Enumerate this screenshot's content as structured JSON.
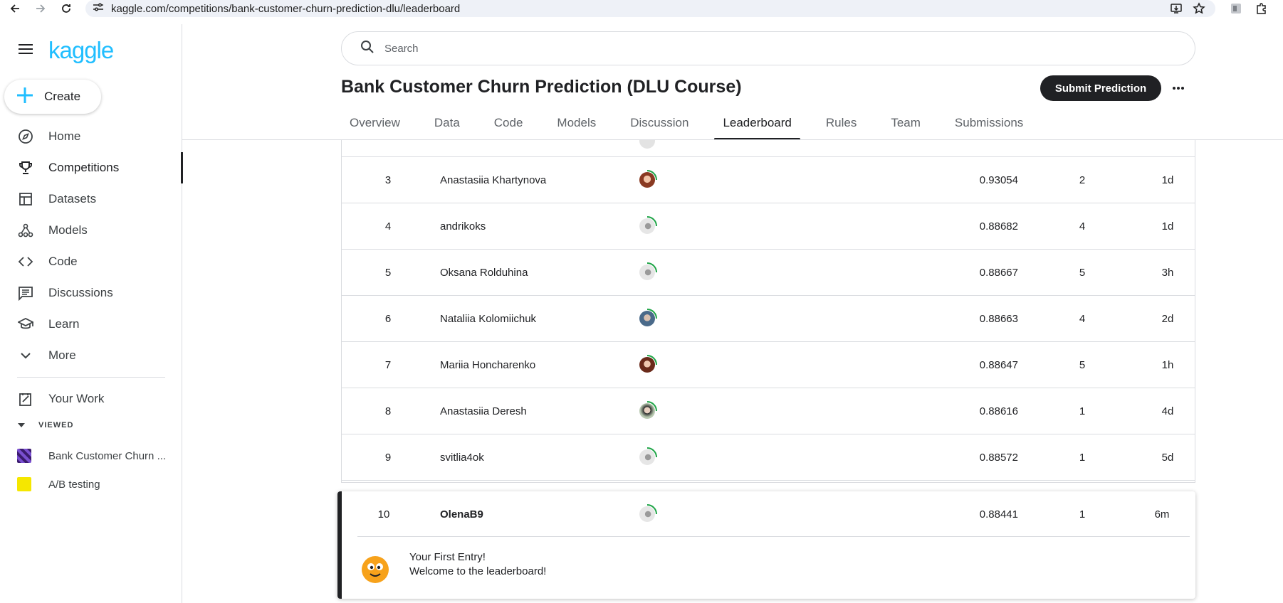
{
  "browser": {
    "url": "kaggle.com/competitions/bank-customer-churn-prediction-dlu/leaderboard"
  },
  "sidebar": {
    "logo": "kaggle",
    "create_label": "Create",
    "items": [
      {
        "label": "Home",
        "icon": "compass-icon"
      },
      {
        "label": "Competitions",
        "icon": "trophy-icon"
      },
      {
        "label": "Datasets",
        "icon": "table-icon"
      },
      {
        "label": "Models",
        "icon": "models-icon"
      },
      {
        "label": "Code",
        "icon": "code-icon"
      },
      {
        "label": "Discussions",
        "icon": "comments-icon"
      },
      {
        "label": "Learn",
        "icon": "school-icon"
      },
      {
        "label": "More",
        "icon": "chevron-down-icon"
      }
    ],
    "your_work": "Your Work",
    "viewed_header": "VIEWED",
    "viewed": [
      {
        "label": "Bank Customer Churn ..."
      },
      {
        "label": "A/B testing"
      }
    ]
  },
  "search": {
    "placeholder": "Search"
  },
  "competition": {
    "title": "Bank Customer Churn Prediction (DLU Course)",
    "submit_label": "Submit Prediction"
  },
  "tabs": [
    "Overview",
    "Data",
    "Code",
    "Models",
    "Discussion",
    "Leaderboard",
    "Rules",
    "Team",
    "Submissions"
  ],
  "active_tab": "Leaderboard",
  "leaderboard": {
    "rows": [
      {
        "rank": "3",
        "name": "Anastasiia Khartynova",
        "score": "0.93054",
        "entries": "2",
        "last": "1d"
      },
      {
        "rank": "4",
        "name": "andrikoks",
        "score": "0.88682",
        "entries": "4",
        "last": "1d"
      },
      {
        "rank": "5",
        "name": "Oksana Rolduhina",
        "score": "0.88667",
        "entries": "5",
        "last": "3h"
      },
      {
        "rank": "6",
        "name": "Nataliia Kolomiichuk",
        "score": "0.88663",
        "entries": "4",
        "last": "2d"
      },
      {
        "rank": "7",
        "name": "Mariia Honcharenko",
        "score": "0.88647",
        "entries": "5",
        "last": "1h"
      },
      {
        "rank": "8",
        "name": "Anastasiia Deresh",
        "score": "0.88616",
        "entries": "1",
        "last": "4d"
      },
      {
        "rank": "9",
        "name": "svitlia4ok",
        "score": "0.88572",
        "entries": "1",
        "last": "5d"
      }
    ],
    "my_entry": {
      "rank": "10",
      "name": "OlenaB9",
      "score": "0.88441",
      "entries": "1",
      "last": "6m"
    },
    "first_entry_title": "Your First Entry!",
    "first_entry_subtitle": "Welcome to the leaderboard!"
  },
  "colors": {
    "brand": "#20beff",
    "dark": "#202124",
    "ring": "#1ea446"
  }
}
